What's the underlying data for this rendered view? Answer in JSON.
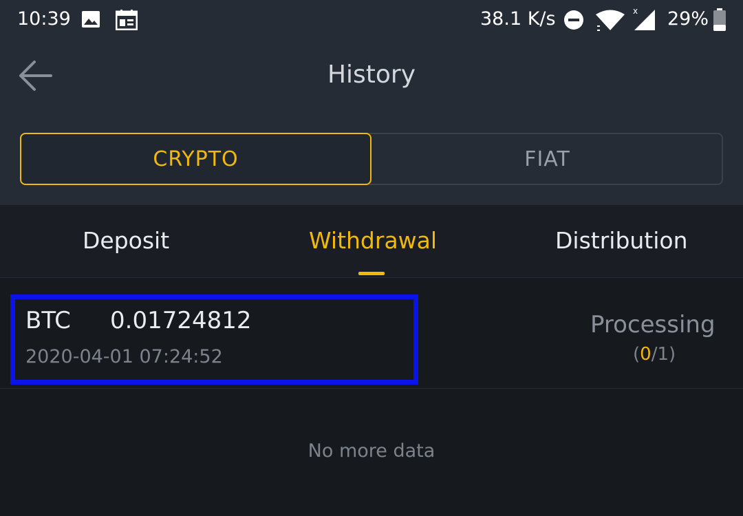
{
  "status_bar": {
    "time": "10:39",
    "net_speed": "38.1 K/s",
    "battery": "29%",
    "icons": [
      "image-icon",
      "calendar-icon",
      "dnd-icon",
      "wifi-icon",
      "signal-icon",
      "battery-icon"
    ]
  },
  "header": {
    "title": "History",
    "back_icon": "arrow-left-icon"
  },
  "segment": {
    "options": [
      "CRYPTO",
      "FIAT"
    ],
    "selected": "CRYPTO"
  },
  "tabs": {
    "items": [
      "Deposit",
      "Withdrawal",
      "Distribution"
    ],
    "active": "Withdrawal"
  },
  "records": [
    {
      "coin": "BTC",
      "amount": "0.01724812",
      "datetime": "2020-04-01 07:24:52",
      "status": "Processing",
      "confirm_open": "(",
      "confirm_done": "0",
      "confirm_rest": "/1)"
    }
  ],
  "footer_text": "No more data",
  "colors": {
    "accent": "#f0b90b",
    "background": "#161a1e",
    "header_bg": "#262c35",
    "highlight": "#0a14e8"
  }
}
